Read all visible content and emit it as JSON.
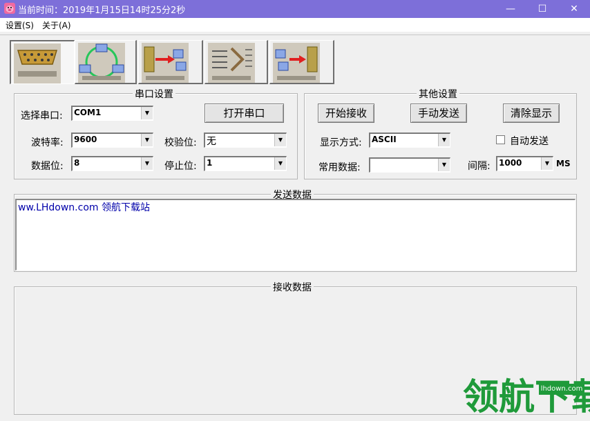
{
  "window": {
    "title": "当前时间：2019年1月15日14时25分2秒",
    "minimize_glyph": "—",
    "maximize_glyph": "☐",
    "close_glyph": "✕"
  },
  "menu": {
    "items": [
      {
        "label": "设置(S)"
      },
      {
        "label": "关于(A)"
      }
    ]
  },
  "toolbar": {
    "buttons": [
      {
        "icon": "serial-port-icon"
      },
      {
        "icon": "network-icon"
      },
      {
        "icon": "tcp-client-icon"
      },
      {
        "icon": "ascii-convert-icon"
      },
      {
        "icon": "tcp-server-icon"
      }
    ]
  },
  "serial_settings": {
    "title": "串口设置",
    "port_label": "选择串口:",
    "port_value": "COM1",
    "open_button": "打开串口",
    "baud_label": "波特率:",
    "baud_value": "9600",
    "parity_label": "校验位:",
    "parity_value": "无",
    "databits_label": "数据位:",
    "databits_value": "8",
    "stopbits_label": "停止位:",
    "stopbits_value": "1"
  },
  "other_settings": {
    "title": "其他设置",
    "start_receive_button": "开始接收",
    "manual_send_button": "手动发送",
    "clear_display_button": "清除显示",
    "display_mode_label": "显示方式:",
    "display_mode_value": "ASCII",
    "auto_send_label": "自动发送",
    "auto_send_checked": false,
    "common_data_label": "常用数据:",
    "common_data_value": "",
    "interval_label": "间隔:",
    "interval_value": "1000",
    "interval_unit": "MS"
  },
  "send_data": {
    "title": "发送数据",
    "content": "ww.LHdown.com 领航下载站"
  },
  "receive_data": {
    "title": "接收数据",
    "content": ""
  },
  "watermark": {
    "text": "领航下载",
    "url": "lhdown.com"
  },
  "colors": {
    "titlebar": "#7d6fd9",
    "send_text": "#0000aa",
    "watermark": "#1f9a3a"
  }
}
